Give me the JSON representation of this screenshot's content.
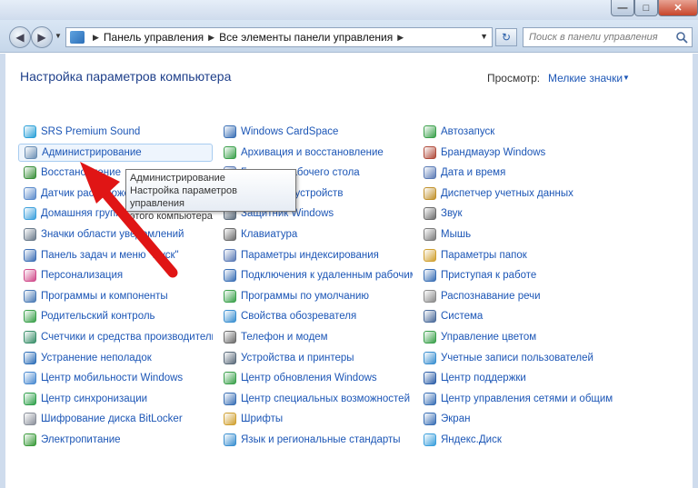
{
  "window": {
    "min_glyph": "—",
    "max_glyph": "□",
    "close_glyph": "✕"
  },
  "nav": {
    "back_glyph": "◀",
    "forward_glyph": "▶",
    "dropdown_glyph": "▼",
    "breadcrumb": [
      "Панель управления",
      "Все элементы панели управления"
    ],
    "sep_glyph": "▶",
    "refresh_glyph": "↻",
    "search_placeholder": "Поиск в панели управления"
  },
  "page": {
    "title": "Настройка параметров компьютера",
    "view_label": "Просмотр:",
    "view_value": "Мелкие значки",
    "view_arrow": "▼"
  },
  "items": {
    "col1": [
      {
        "label": "SRS Premium Sound",
        "icon": "sound-effects-icon",
        "color": "#2aa0d8"
      },
      {
        "label": "Администрирование",
        "icon": "admin-tools-icon",
        "color": "#6b8fb5",
        "highlighted": true
      },
      {
        "label": "Восстановление",
        "icon": "recovery-icon",
        "color": "#3a8f3a"
      },
      {
        "label": "Датчик расположения и другие датчики",
        "icon": "sensor-icon",
        "color": "#5a8acb"
      },
      {
        "label": "Домашняя группа",
        "icon": "homegroup-icon",
        "color": "#3a9fdc"
      },
      {
        "label": "Значки области уведомлений",
        "icon": "notification-icons-icon",
        "color": "#6a7a8a"
      },
      {
        "label": "Панель задач и меню \"Пуск\"",
        "icon": "taskbar-icon",
        "color": "#3d6fb5"
      },
      {
        "label": "Персонализация",
        "icon": "personalization-icon",
        "color": "#d04a8a"
      },
      {
        "label": "Программы и компоненты",
        "icon": "programs-icon",
        "color": "#4a7ab5"
      },
      {
        "label": "Родительский контроль",
        "icon": "parental-control-icon",
        "color": "#3aa04a"
      },
      {
        "label": "Счетчики и средства производительности",
        "icon": "performance-icon",
        "color": "#3a8f6a"
      },
      {
        "label": "Устранение неполадок",
        "icon": "troubleshooting-icon",
        "color": "#2e6fb8"
      },
      {
        "label": "Центр мобильности Windows",
        "icon": "mobility-center-icon",
        "color": "#4a8ad0"
      },
      {
        "label": "Центр синхронизации",
        "icon": "sync-center-icon",
        "color": "#2fa04a"
      },
      {
        "label": "Шифрование диска BitLocker",
        "icon": "bitlocker-icon",
        "color": "#8a8f9a"
      },
      {
        "label": "Электропитание",
        "icon": "power-options-icon",
        "color": "#3a9a3a"
      }
    ],
    "col2": [
      {
        "label": "Windows CardSpace",
        "icon": "cardspace-icon",
        "color": "#3a6fb5"
      },
      {
        "label": "Архивация и восстановление",
        "icon": "backup-icon",
        "color": "#3aa04a"
      },
      {
        "label": "Гаджеты рабочего стола",
        "icon": "gadgets-icon",
        "color": "#5a7ab5"
      },
      {
        "label": "Диспетчер устройств",
        "icon": "device-manager-icon",
        "color": "#6a7a8a"
      },
      {
        "label": "Защитник Windows",
        "icon": "defender-icon",
        "color": "#5a6a7a"
      },
      {
        "label": "Клавиатура",
        "icon": "keyboard-icon",
        "color": "#6a6a6a"
      },
      {
        "label": "Параметры индексирования",
        "icon": "indexing-icon",
        "color": "#5a7ab5"
      },
      {
        "label": "Подключения к удаленным рабочим столам",
        "icon": "remote-desktop-icon",
        "color": "#3a6fb5"
      },
      {
        "label": "Программы по умолчанию",
        "icon": "default-programs-icon",
        "color": "#3aa04a"
      },
      {
        "label": "Свойства обозревателя",
        "icon": "internet-options-icon",
        "color": "#3a8fd0"
      },
      {
        "label": "Телефон и модем",
        "icon": "phone-modem-icon",
        "color": "#6a6a6a"
      },
      {
        "label": "Устройства и принтеры",
        "icon": "printers-icon",
        "color": "#5a6a7a"
      },
      {
        "label": "Центр обновления Windows",
        "icon": "windows-update-icon",
        "color": "#3aa04a"
      },
      {
        "label": "Центр специальных возможностей",
        "icon": "accessibility-icon",
        "color": "#3a6fb5"
      },
      {
        "label": "Шрифты",
        "icon": "fonts-icon",
        "color": "#d0a030"
      },
      {
        "label": "Язык и региональные стандарты",
        "icon": "region-icon",
        "color": "#3a8fd0"
      }
    ],
    "col3": [
      {
        "label": "Автозапуск",
        "icon": "autoplay-icon",
        "color": "#3aa04a"
      },
      {
        "label": "Брандмауэр Windows",
        "icon": "firewall-icon",
        "color": "#b04a3a"
      },
      {
        "label": "Дата и время",
        "icon": "date-time-icon",
        "color": "#5a7ab5"
      },
      {
        "label": "Диспетчер учетных данных",
        "icon": "credential-manager-icon",
        "color": "#c0902a"
      },
      {
        "label": "Звук",
        "icon": "sound-icon",
        "color": "#6a6a6a"
      },
      {
        "label": "Мышь",
        "icon": "mouse-icon",
        "color": "#7a7a7a"
      },
      {
        "label": "Параметры папок",
        "icon": "folder-options-icon",
        "color": "#d0a030"
      },
      {
        "label": "Приступая к работе",
        "icon": "getting-started-icon",
        "color": "#3a6fb5"
      },
      {
        "label": "Распознавание речи",
        "icon": "speech-recognition-icon",
        "color": "#8a8a8a"
      },
      {
        "label": "Система",
        "icon": "system-icon",
        "color": "#4a6a9a"
      },
      {
        "label": "Управление цветом",
        "icon": "color-management-icon",
        "color": "#3aa04a"
      },
      {
        "label": "Учетные записи пользователей",
        "icon": "user-accounts-icon",
        "color": "#3a8fd0"
      },
      {
        "label": "Центр поддержки",
        "icon": "action-center-icon",
        "color": "#2e5fa8"
      },
      {
        "label": "Центр управления сетями и общим доступом",
        "icon": "network-center-icon",
        "color": "#3a6fb5"
      },
      {
        "label": "Экран",
        "icon": "display-icon",
        "color": "#3a6fb5"
      },
      {
        "label": "Яндекс.Диск",
        "icon": "yandex-disk-icon",
        "color": "#3a9fdc"
      }
    ]
  },
  "tooltip": {
    "line1": "Администрирование",
    "line2": "Настройка параметров управления",
    "line3": "этого компьютера"
  },
  "colors": {
    "link": "#1c56b6",
    "heading": "#1e3f8a",
    "arrow": "#e01515"
  }
}
